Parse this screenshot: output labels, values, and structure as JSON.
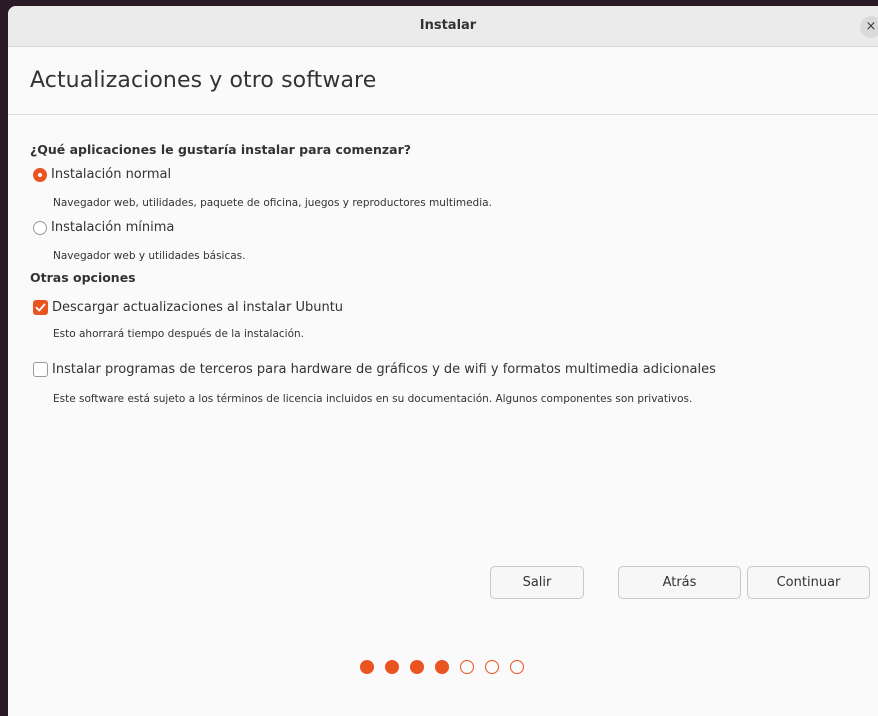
{
  "window": {
    "title": "Instalar",
    "close_glyph": "×"
  },
  "page": {
    "title": "Actualizaciones y otro software"
  },
  "apps_section": {
    "heading": "¿Qué aplicaciones le gustaría instalar para comenzar?",
    "options": [
      {
        "label": "Instalación normal",
        "description": "Navegador web, utilidades, paquete de oficina, juegos y reproductores multimedia.",
        "selected": true
      },
      {
        "label": "Instalación mínima",
        "description": "Navegador web y utilidades básicas.",
        "selected": false
      }
    ]
  },
  "other_section": {
    "heading": "Otras opciones",
    "options": [
      {
        "label": "Descargar actualizaciones al instalar Ubuntu",
        "description": "Esto ahorrará tiempo después de la instalación.",
        "checked": true
      },
      {
        "label": "Instalar programas de terceros para hardware de gráficos y de wifi y formatos multimedia adicionales",
        "description": "Este software está sujeto a los términos de licencia incluidos en su documentación. Algunos componentes son privativos.",
        "checked": false
      }
    ]
  },
  "buttons": {
    "quit": "Salir",
    "back": "Atrás",
    "continue": "Continuar"
  },
  "progress": {
    "current_step": 4,
    "total_steps": 7,
    "accent_color": "#e95420"
  },
  "icons": {
    "close": "close-icon",
    "check": "checkmark-icon"
  }
}
